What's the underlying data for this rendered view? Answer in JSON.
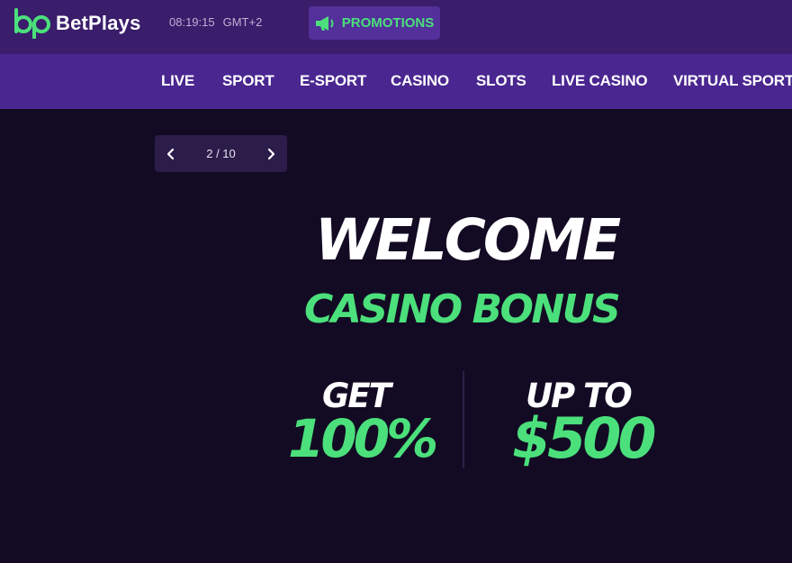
{
  "header": {
    "brand": "BetPlays",
    "time": "08:19:15",
    "timezone": "GMT+2",
    "promotions_label": "PROMOTIONS",
    "accent_color": "#4be07b"
  },
  "nav": {
    "items": [
      {
        "label": "LIVE"
      },
      {
        "label": "SPORT"
      },
      {
        "label": "E-SPORT"
      },
      {
        "label": "CASINO"
      },
      {
        "label": "SLOTS"
      },
      {
        "label": "LIVE CASINO"
      },
      {
        "label": "VIRTUAL SPORT"
      }
    ]
  },
  "slider": {
    "counter": "2 / 10",
    "prev_icon": "chevron-left-icon",
    "next_icon": "chevron-right-icon"
  },
  "banner": {
    "line1": "WELCOME",
    "line2": "CASINO BONUS",
    "left_top": "GET",
    "left_bottom": "100%",
    "right_top": "UP TO",
    "right_bottom": "$500"
  }
}
